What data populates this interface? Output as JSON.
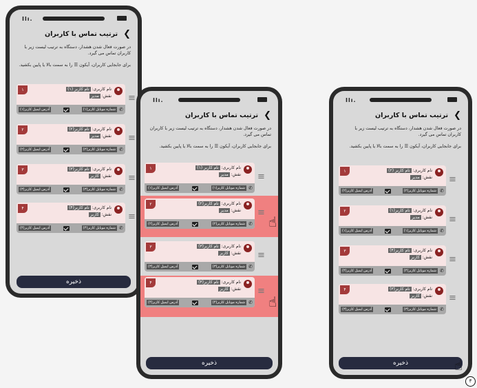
{
  "screen": {
    "back_icon": "chevron-right-icon",
    "title": "ترتیب تماس با کاربران",
    "desc1": "در صورت فعال شدن هشدار، دستگاه به ترتیب لیست زیر با کاربران تماس می گیرد.",
    "desc2": "برای جابجایی کاربران، آیکون ☰ را به سمت بالا یا پایین بکشید.",
    "save_label": "ذخیره",
    "name_label": "نام کاربری:",
    "role_label": "نقش:",
    "step_number": "۳"
  },
  "phone1": {
    "cards": [
      {
        "num": "۱",
        "name": "نام کاربر (۱)",
        "role": "مدیر",
        "phone": "شماره موبایل کاربر(۱)",
        "email": "آدرس ایمیل کاربر(۱)"
      },
      {
        "num": "۲",
        "name": "نام کاربر(۲)",
        "role": "مدیر",
        "phone": "شماره موبایل کاربر(۲)",
        "email": "آدرس ایمیل کاربر(۲)"
      },
      {
        "num": "۳",
        "name": "نام کاربر(۳)",
        "role": "کاربر",
        "phone": "شماره موبایل کاربر(۳)",
        "email": "آدرس ایمیل کاربر(۳)"
      },
      {
        "num": "۴",
        "name": "نام کاربر(۴)",
        "role": "کاربر",
        "phone": "شماره موبایل کاربر(۴)",
        "email": "آدرس ایمیل کاربر(۴)"
      }
    ]
  },
  "phone2": {
    "cards": [
      {
        "num": "۱",
        "name": "نام کاربر (۱)",
        "role": "مدیر",
        "phone": "شماره موبایل کاربر(۱)",
        "email": "آدرس ایمیل کاربر(۱)"
      },
      {
        "num": "۲",
        "name": "نام کاربر(۲)",
        "role": "مدیر",
        "phone": "شماره موبایل کاربر(۲)",
        "email": "آدرس ایمیل کاربر(۲)"
      },
      {
        "num": "۳",
        "name": "نام کاربر(۳)",
        "role": "کاربر",
        "phone": "شماره موبایل کاربر(۳)",
        "email": "آدرس ایمیل کاربر(۳)"
      },
      {
        "num": "۴",
        "name": "نام کاربر(۴)",
        "role": "کاربر",
        "phone": "شماره موبایل کاربر(۴)",
        "email": "آدرس ایمیل کاربر(۴)"
      }
    ]
  },
  "phone3": {
    "cards": [
      {
        "num": "۱",
        "name": "نام کاربر (۲)",
        "role": "مدیر",
        "phone": "شماره موبایل کاربر(۲)",
        "email": "آدرس ایمیل کاربر(۲)"
      },
      {
        "num": "۲",
        "name": "نام کاربر(۱)",
        "role": "مدیر",
        "phone": "شماره موبایل کاربر(۱)",
        "email": "آدرس ایمیل کاربر(۱)"
      },
      {
        "num": "۳",
        "name": "نام کاربر(۴)",
        "role": "کاربر",
        "phone": "شماره موبایل کاربر(۴)",
        "email": "آدرس ایمیل کاربر(۴)"
      },
      {
        "num": "۴",
        "name": "نام کاربر(۳)",
        "role": "کاربر",
        "phone": "شماره موبایل کاربر(۳)",
        "email": "آدرس ایمیل کاربر(۳)"
      }
    ]
  }
}
